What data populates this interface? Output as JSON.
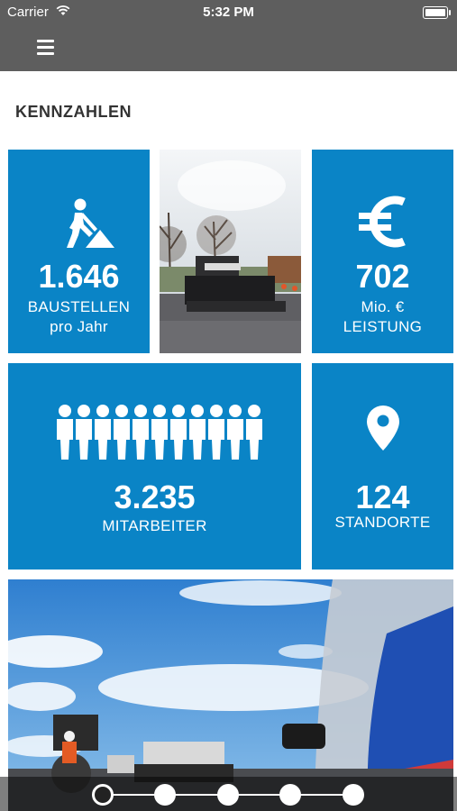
{
  "status_bar": {
    "carrier": "Carrier",
    "time": "5:32 PM"
  },
  "page": {
    "title": "KENNZAHLEN"
  },
  "tiles": {
    "baustellen": {
      "value": "1.646",
      "line1": "BAUSTELLEN",
      "line2": "pro Jahr",
      "icon": "construction-worker-icon"
    },
    "leistung": {
      "value": "702",
      "line1": "Mio. €",
      "line2": "LEISTUNG",
      "icon": "euro-icon"
    },
    "mitarbeiter": {
      "value": "3.235",
      "line1": "MITARBEITER",
      "icon": "people-icon"
    },
    "standorte": {
      "value": "124",
      "line1": "STANDORTE",
      "icon": "location-pin-icon"
    }
  },
  "carousel": {
    "dot_count": 5,
    "active_index": 0
  },
  "colors": {
    "tile_blue": "#0a84c6",
    "header_gray": "#5e5e5e"
  }
}
